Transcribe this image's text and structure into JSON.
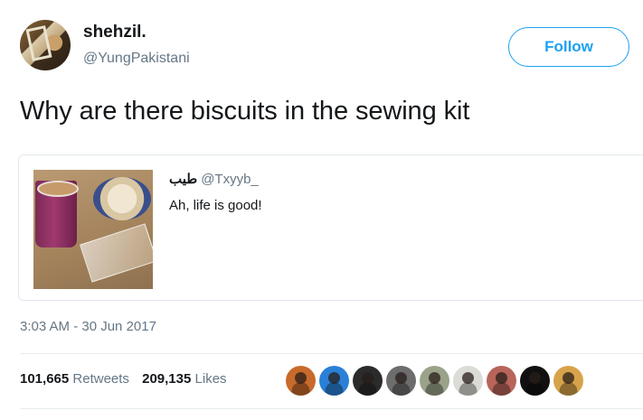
{
  "tweet": {
    "display_name": "shehzil.",
    "handle": "@YungPakistani",
    "follow_label": "Follow",
    "text": "Why are there biscuits in the sewing kit",
    "timestamp": "3:03 AM - 30 Jun 2017"
  },
  "quoted_tweet": {
    "name": "طيب",
    "handle": "@Txyyb_",
    "text": "Ah, life is good!"
  },
  "stats": {
    "retweets_count": "101,665",
    "retweets_label": "Retweets",
    "likes_count": "209,135",
    "likes_label": "Likes"
  },
  "likers": [
    {
      "icon": "user-avatar-icon",
      "color": "#c86a2b"
    },
    {
      "icon": "user-avatar-icon",
      "color": "#2a7fd6"
    },
    {
      "icon": "user-avatar-icon",
      "color": "#2b2b2b"
    },
    {
      "icon": "user-avatar-icon",
      "color": "#6d6d6d"
    },
    {
      "icon": "user-avatar-icon",
      "color": "#9aa38a"
    },
    {
      "icon": "user-avatar-icon",
      "color": "#dcdcd6"
    },
    {
      "icon": "user-avatar-icon",
      "color": "#b8645a"
    },
    {
      "icon": "user-avatar-icon",
      "color": "#111111"
    },
    {
      "icon": "user-avatar-icon",
      "color": "#d7a34a"
    }
  ],
  "colors": {
    "accent": "#1da1f2",
    "secondary_text": "#657786",
    "primary_text": "#14171a",
    "border": "#e1e8ed"
  }
}
